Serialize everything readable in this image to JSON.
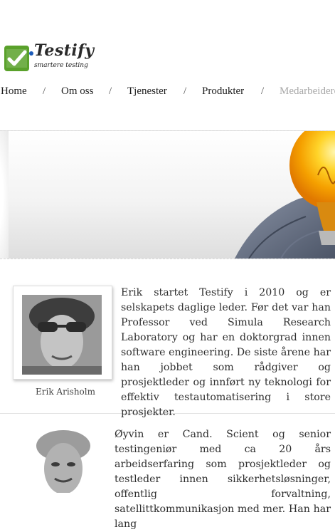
{
  "logo": {
    "name": "Testify",
    "tagline": "smartere testing"
  },
  "nav": {
    "items": [
      "Home",
      "Om oss",
      "Tjenester",
      "Produkter",
      "Medarbeidere"
    ],
    "separator": "/"
  },
  "members": [
    {
      "name": "Erik Arisholm",
      "bio": "Erik startet Testify i 2010 og er selskapets daglige leder. Før det var han Professor ved Simula Research Laboratory og har en doktorgrad innen software engineering.  De siste årene har han jobbet som rådgiver og prosjektleder og innført ny teknologi for effektiv testautomatisering i store prosjekter."
    },
    {
      "bio": "Øyvin er Cand. Scient og senior testingeniør med ca 20 års arbeidserfaring som prosjektleder og testleder innen sikkerhetsløsninger, offentlig forvaltning, satellittkommunikasjon med mer. Han har lang"
    }
  ],
  "colors": {
    "accent_green": "#5aa12b",
    "nav_current": "#a8a8a8"
  }
}
